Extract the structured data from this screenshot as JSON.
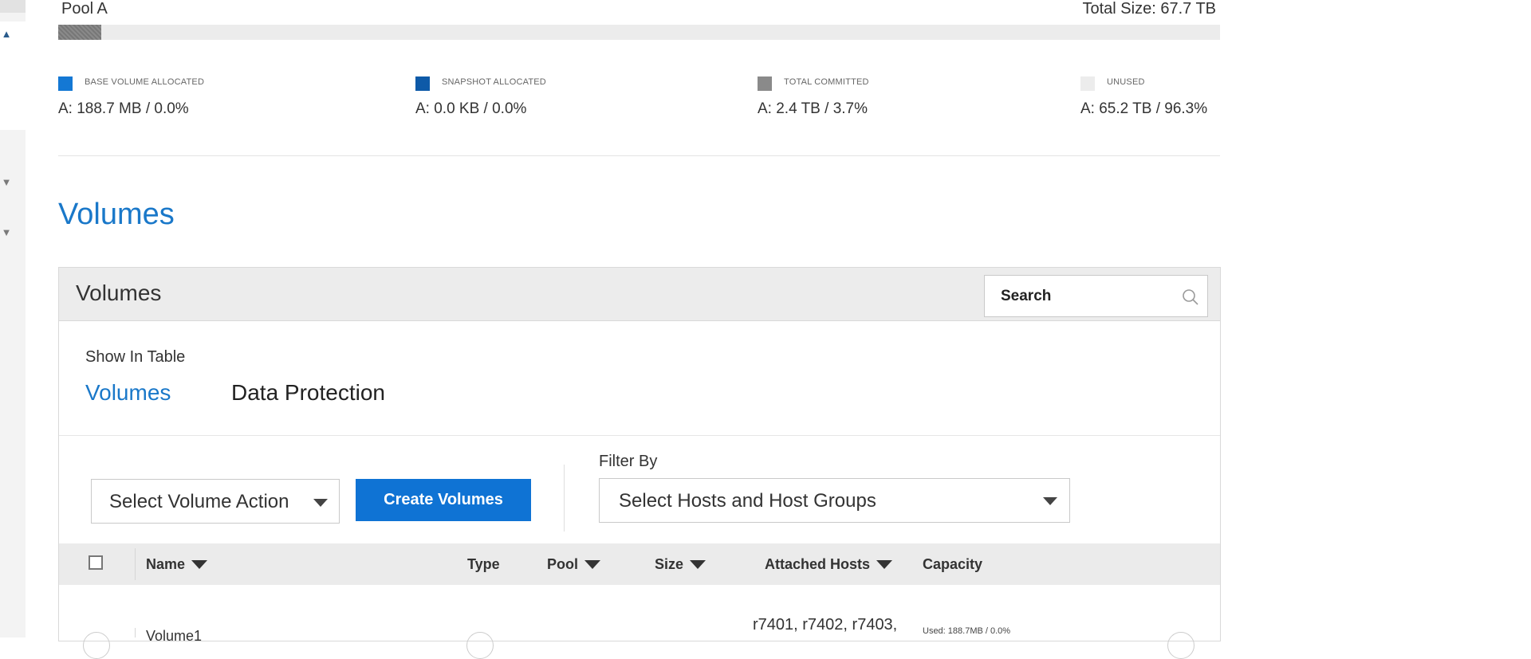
{
  "pool": {
    "name": "Pool A",
    "total_size": "Total Size: 67.7 TB",
    "committed_fraction": 0.037
  },
  "legend": [
    {
      "label": "BASE VOLUME ALLOCATED",
      "value": "A: 188.7 MB / 0.0%",
      "color": "#1478d4"
    },
    {
      "label": "SNAPSHOT ALLOCATED",
      "value": "A: 0.0 KB / 0.0%",
      "color": "#0e5aa8"
    },
    {
      "label": "TOTAL COMMITTED",
      "value": "A: 2.4 TB / 3.7%",
      "color": "#8a8a8a"
    },
    {
      "label": "UNUSED",
      "value": "A: 65.2 TB / 96.3%",
      "color": "#ececec"
    }
  ],
  "section_title": "Volumes",
  "panel": {
    "title": "Volumes",
    "search_placeholder": "Search",
    "show_in_table_label": "Show In Table",
    "tabs": [
      {
        "label": "Volumes",
        "active": true
      },
      {
        "label": "Data Protection",
        "active": false
      }
    ]
  },
  "toolbar": {
    "select_action": "Select Volume Action",
    "create_button": "Create Volumes",
    "filter_label": "Filter By",
    "filter_select": "Select Hosts and Host Groups"
  },
  "table": {
    "columns": [
      "Name",
      "Type",
      "Pool",
      "Size",
      "Attached Hosts",
      "Capacity"
    ],
    "rows": [
      {
        "name": "Volume1",
        "hosts": "r7401, r7402, r7403,",
        "capacity": "Used: 188.7MB / 0.0%"
      }
    ]
  },
  "colors": {
    "accent": "#1a78c9",
    "button": "#0f73d4"
  }
}
